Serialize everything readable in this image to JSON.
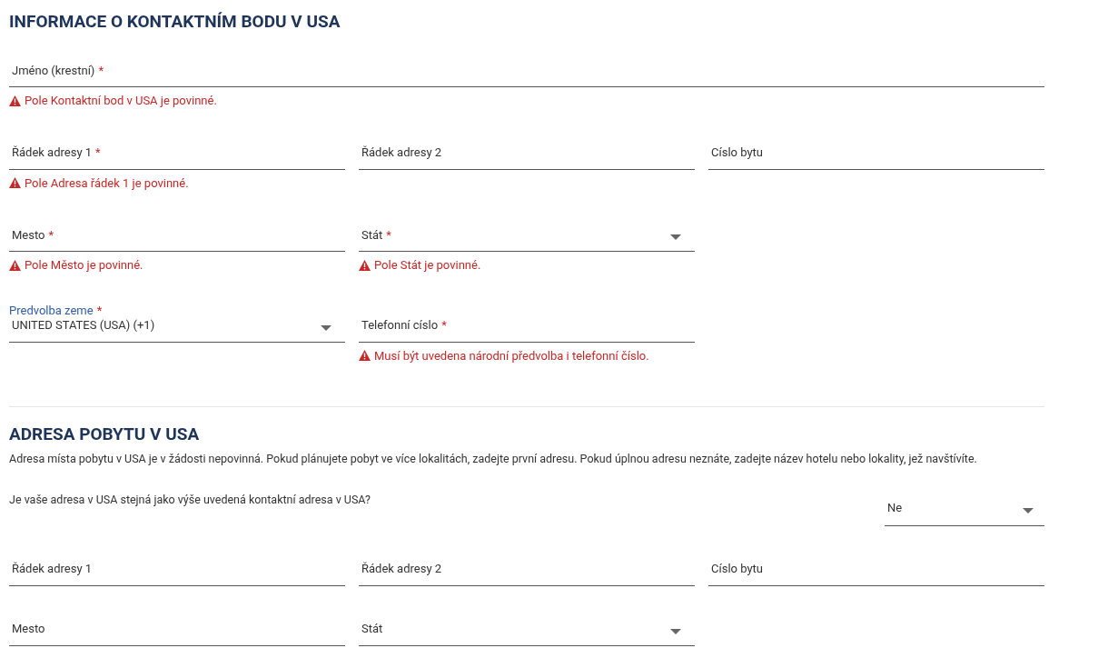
{
  "sections": [
    {
      "title": "INFORMACE O KONTAKTNÍM BODU V USA",
      "rows": [
        [
          {
            "kind": "text",
            "label": "Jméno (krestní)",
            "required_mark": "*",
            "error": "Pole Kontaktní bod v USA je povinné."
          }
        ],
        [
          {
            "kind": "text",
            "label": "Řádek adresy 1",
            "required_mark": "*",
            "error": "Pole Adresa řádek 1 je povinné."
          },
          {
            "kind": "text",
            "label": "Řádek adresy 2"
          },
          {
            "kind": "text",
            "label": "Císlo bytu"
          }
        ],
        [
          {
            "kind": "text",
            "label": "Mesto",
            "required_mark": "*",
            "error": "Pole Město je povinné."
          },
          {
            "kind": "select",
            "label": "Stát",
            "required_mark": "*",
            "error": "Pole Stát je povinné."
          }
        ],
        [
          {
            "kind": "select",
            "label": "Predvolba zeme",
            "required_mark": "*",
            "value": "UNITED STATES (USA) (+1)"
          },
          {
            "kind": "text",
            "label": "Telefonní císlo",
            "required_mark": "*",
            "error": "Musí být uvedena národní předvolba i telefonní číslo."
          }
        ]
      ]
    },
    {
      "title": "ADRESA POBYTU V USA",
      "description": "Adresa místa pobytu v USA je v žádosti nepovinná. Pokud plánujete pobyt ve více lokalitách, zadejte první adresu. Pokud úplnou adresu neznáte, zadejte název hotelu nebo lokality, jež navštívíte.",
      "question": {
        "label": "Je vaše adresa v USA stejná jako výše uvedená kontaktní adresa v USA?",
        "value": "Ne"
      },
      "rows": [
        [
          {
            "kind": "text",
            "label": "Řádek adresy 1"
          },
          {
            "kind": "text",
            "label": "Řádek adresy 2"
          },
          {
            "kind": "text",
            "label": "Císlo bytu"
          }
        ],
        [
          {
            "kind": "text",
            "label": "Mesto"
          },
          {
            "kind": "select",
            "label": "Stát"
          }
        ]
      ]
    }
  ]
}
